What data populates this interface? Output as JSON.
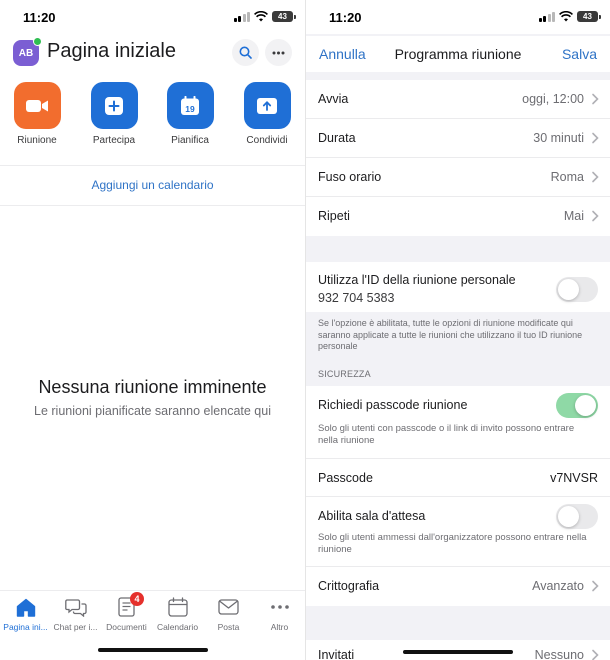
{
  "left": {
    "status": {
      "time": "11:20",
      "battery": "43"
    },
    "header": {
      "avatar_initials": "AB",
      "title": "Pagina iniziale"
    },
    "actions": [
      {
        "label": "Riunione",
        "color": "#f26d2e",
        "icon": "video-camera-icon"
      },
      {
        "label": "Partecipa",
        "color": "#1f6fd6",
        "icon": "plus-icon"
      },
      {
        "label": "Pianifica",
        "color": "#1f6fd6",
        "icon": "calendar-icon",
        "day": "19"
      },
      {
        "label": "Condividi",
        "color": "#1f6fd6",
        "icon": "share-screen-icon"
      }
    ],
    "add_calendar": "Aggiungi un calendario",
    "empty": {
      "title": "Nessuna riunione imminente",
      "subtitle": "Le riunioni pianificate saranno elencate qui"
    },
    "bottom_nav": [
      {
        "label": "Pagina ini...",
        "icon": "home-icon",
        "active": true
      },
      {
        "label": "Chat per i...",
        "icon": "chat-icon",
        "active": false
      },
      {
        "label": "Documenti",
        "icon": "document-icon",
        "active": false,
        "badge": "4"
      },
      {
        "label": "Calendario",
        "icon": "calendar-icon",
        "active": false
      },
      {
        "label": "Posta",
        "icon": "mail-icon",
        "active": false
      },
      {
        "label": "Altro",
        "icon": "more-icon",
        "active": false
      }
    ]
  },
  "right": {
    "status": {
      "time": "11:20",
      "battery": "43"
    },
    "nav": {
      "cancel": "Annulla",
      "title": "Programma riunione",
      "save": "Salva"
    },
    "schedule_rows": [
      {
        "label": "Avvia",
        "value": "oggi, 12:00"
      },
      {
        "label": "Durata",
        "value": "30 minuti"
      },
      {
        "label": "Fuso orario",
        "value": "Roma"
      },
      {
        "label": "Ripeti",
        "value": "Mai"
      }
    ],
    "personal_id": {
      "label": "Utilizza l'ID della riunione personale",
      "id": "932 704 5383",
      "enabled": false,
      "note": "Se l'opzione è abilitata, tutte le opzioni di riunione modificate qui saranno applicate a tutte le riunioni che utilizzano il tuo ID riunione personale"
    },
    "security_header": "SICUREZZA",
    "passcode_required": {
      "label": "Richiedi passcode riunione",
      "enabled": true,
      "description": "Solo gli utenti con passcode o il link di invito possono entrare nella riunione"
    },
    "passcode": {
      "label": "Passcode",
      "value": "v7NVSR"
    },
    "waiting_room": {
      "label": "Abilita sala d'attesa",
      "enabled": false,
      "description": "Solo gli utenti ammessi dall'organizzatore possono entrare nella riunione"
    },
    "encryption": {
      "label": "Crittografia",
      "value": "Avanzato"
    },
    "invitees": {
      "label": "Invitati",
      "value": "Nessuno"
    }
  },
  "colors": {
    "accent": "#2f73c6",
    "zoom_blue": "#1f6fd6",
    "orange": "#f26d2e",
    "toggle_on": "#8fd9a6",
    "badge": "#e5302c"
  }
}
